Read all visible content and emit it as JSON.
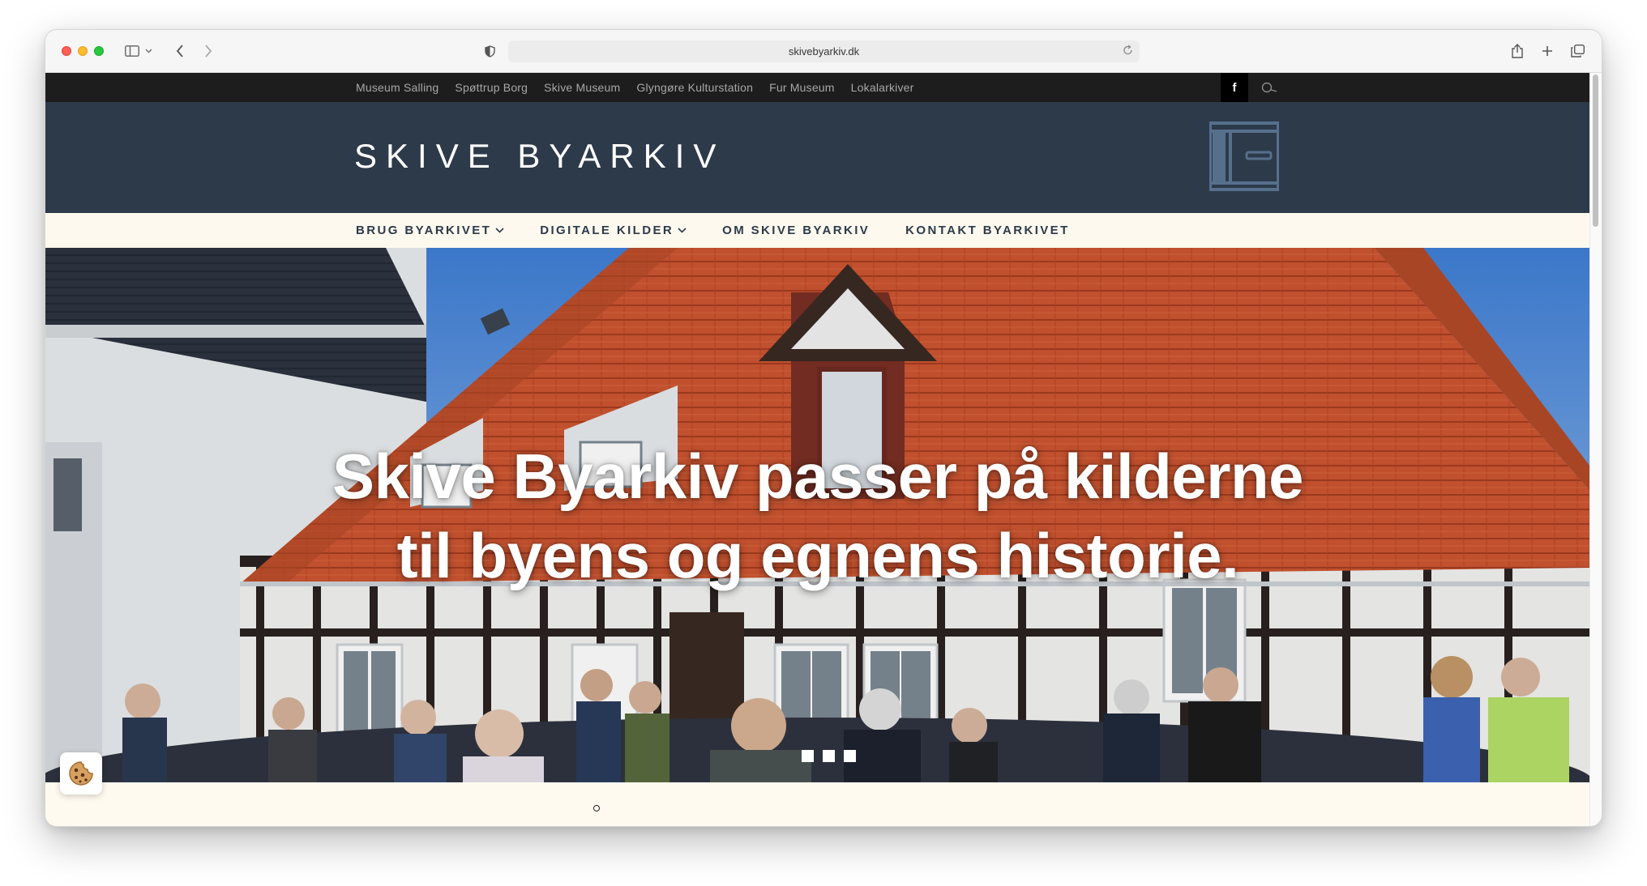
{
  "browser": {
    "url": "skivebyarkiv.dk",
    "icons": [
      "sidebar-icon",
      "chevron-down-icon",
      "back-icon",
      "forward-icon",
      "shield-icon",
      "reload-icon",
      "share-icon",
      "new-tab-icon",
      "tabs-overview-icon"
    ]
  },
  "topbar": {
    "links": [
      "Museum Salling",
      "Spøttrup Borg",
      "Skive Museum",
      "Glyngøre Kulturstation",
      "Fur Museum",
      "Lokalarkiver"
    ],
    "facebook_label": "f"
  },
  "header": {
    "title": "SKIVE BYARKIV"
  },
  "mainnav": {
    "items": [
      {
        "label": "BRUG BYARKIVET",
        "has_dropdown": true
      },
      {
        "label": "DIGITALE KILDER",
        "has_dropdown": true
      },
      {
        "label": "OM SKIVE BYARKIV",
        "has_dropdown": false
      },
      {
        "label": "KONTAKT BYARKIVET",
        "has_dropdown": false
      }
    ]
  },
  "hero": {
    "headline_line1": "Skive Byarkiv passer på kilderne",
    "headline_line2": "til byens og egnens historie.",
    "slide_count": 3
  },
  "colors": {
    "header_bg": "#2c3a4a",
    "topbar_bg": "#1d1d1d",
    "nav_bg": "#fdf9ee",
    "roof": "#c8512a"
  }
}
